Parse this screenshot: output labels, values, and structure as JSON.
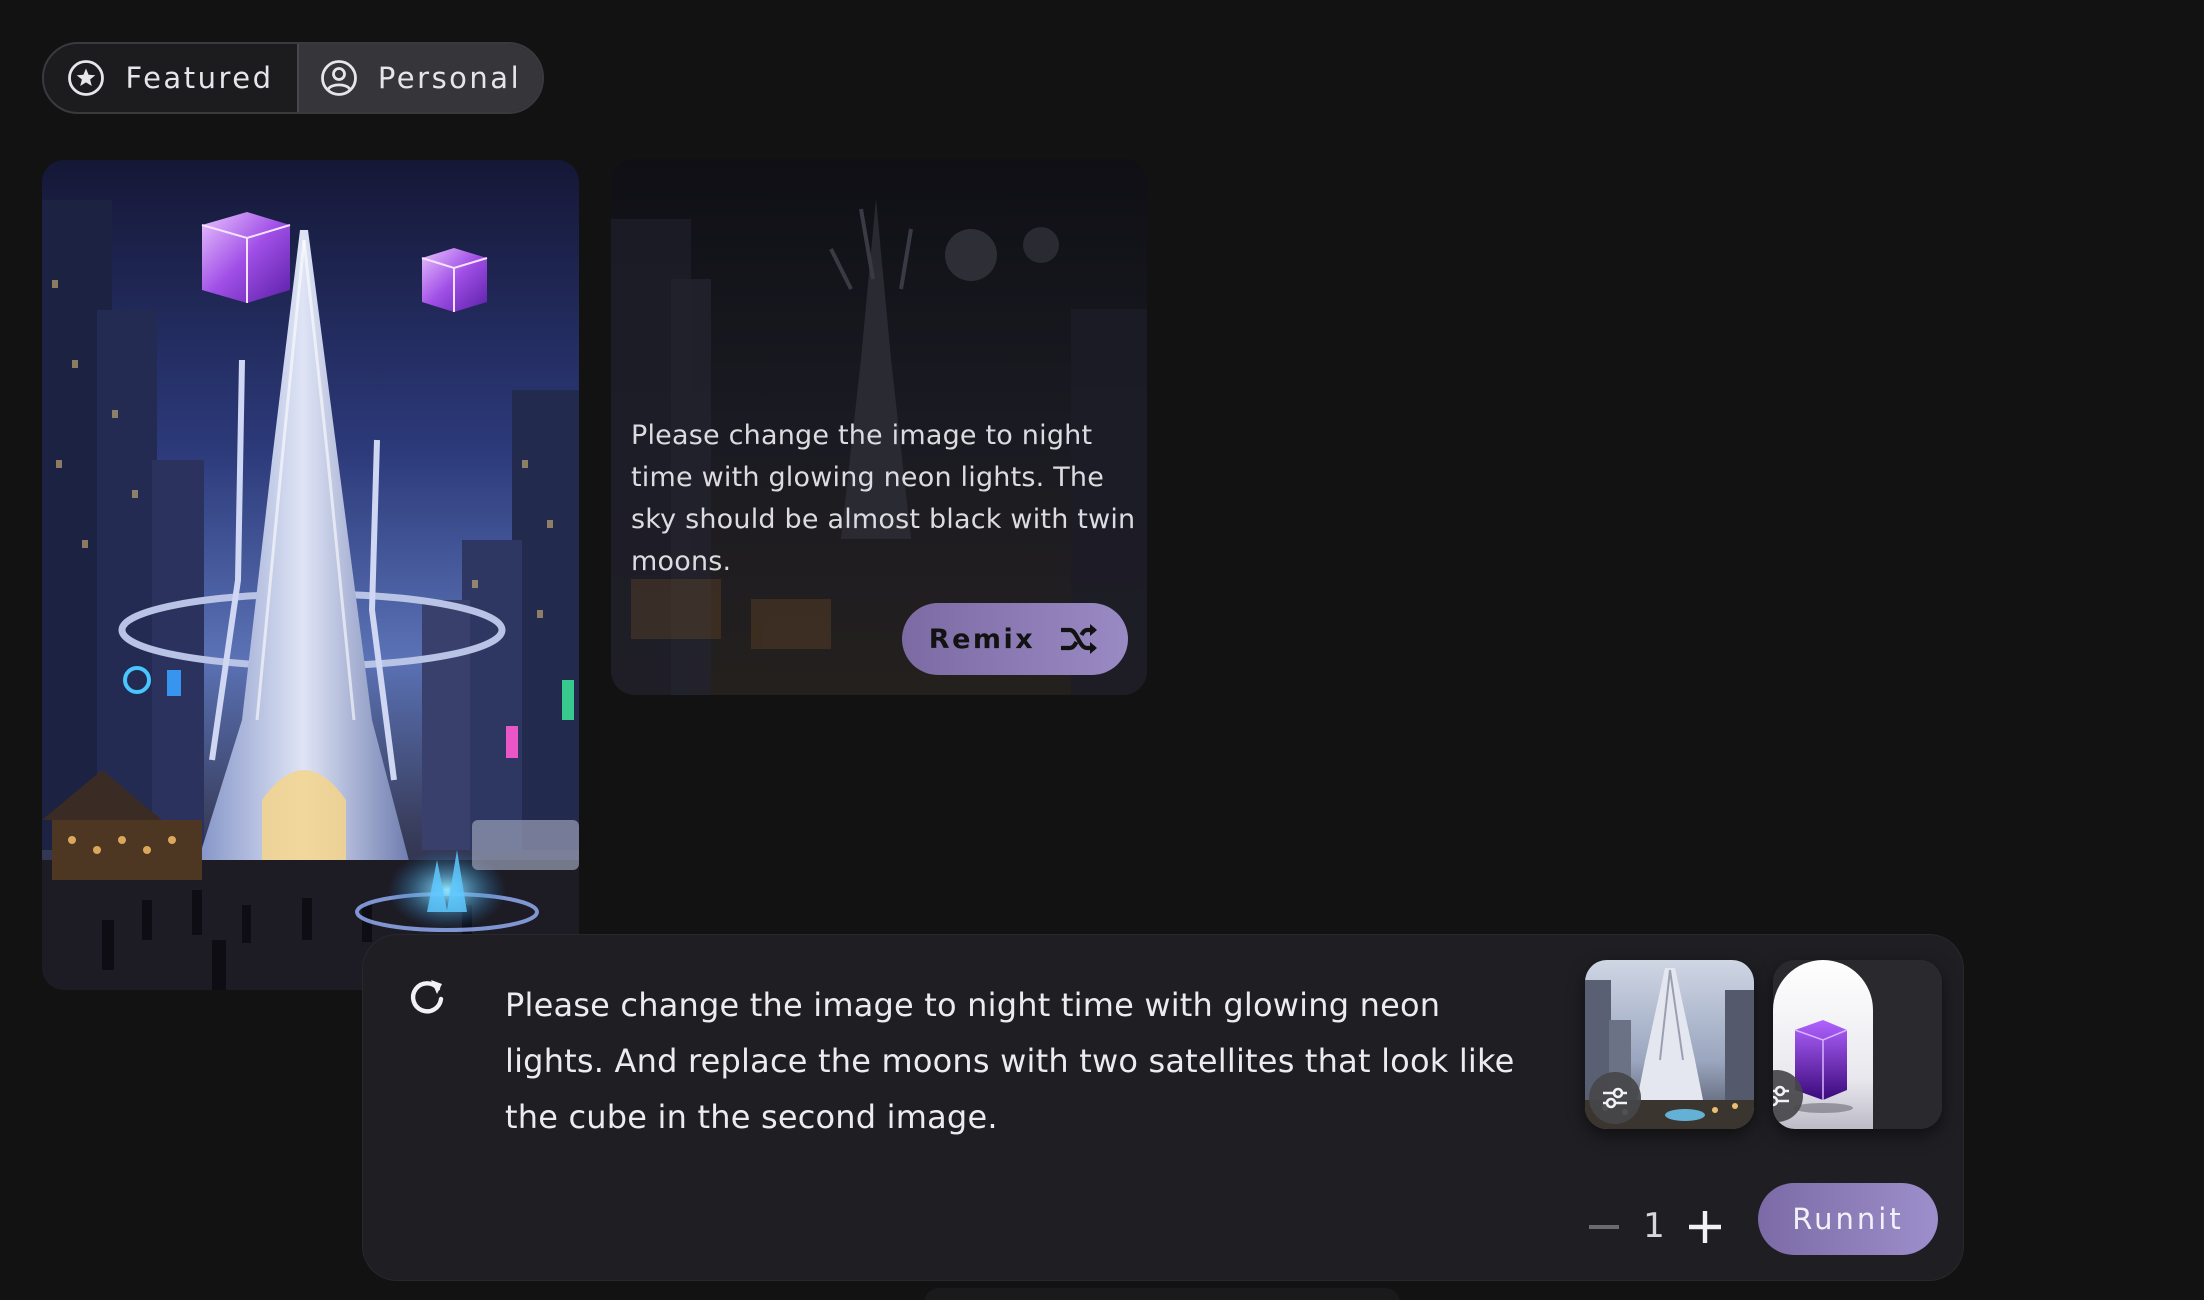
{
  "tabs": {
    "featured_label": "Featured",
    "featured_icon": "star-circle-icon",
    "personal_label": "Personal",
    "personal_icon": "user-circle-icon",
    "active": "Personal"
  },
  "gallery": {
    "image_alt": "futuristic city with twin purple cubes",
    "prompt_text": "Please change the image to night time with glowing neon lights.  The sky should be almost black with twin moons.",
    "remix_label": "Remix",
    "remix_icon": "shuffle-icon"
  },
  "composer": {
    "refresh_icon": "refresh-icon",
    "prompt_text": "Please change the image to night time with glowing neon lights. And replace the moons with two satellites that look like the cube in the second image.",
    "reference_images": [
      {
        "name": "city-tower-reference",
        "adjust_icon": "sliders-icon"
      },
      {
        "name": "purple-cube-reference",
        "adjust_icon": "sliders-icon"
      }
    ],
    "quantity_value": "1",
    "minus_icon": "minus-icon",
    "plus_icon": "plus-icon",
    "run_label": "Runnit"
  },
  "colors": {
    "background": "#121212",
    "panel": "#1f1e23",
    "accent_start": "#7b6aa6",
    "accent_end": "#9d8fcb"
  }
}
